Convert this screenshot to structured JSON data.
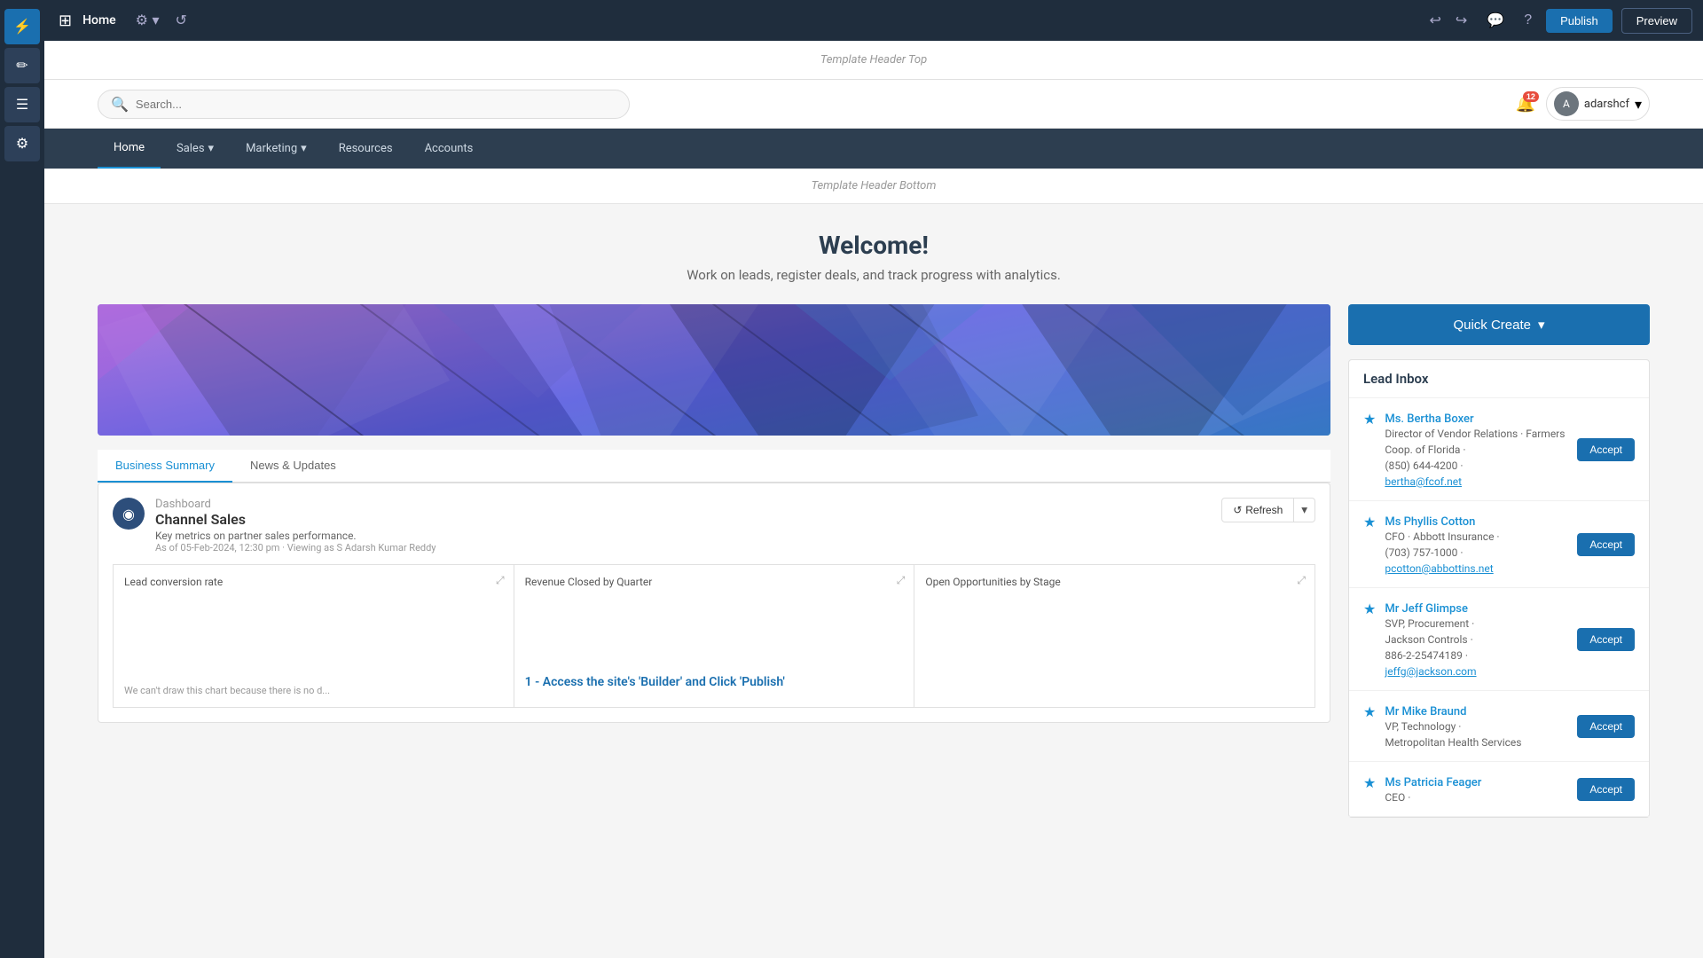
{
  "leftSidebar": {
    "icons": [
      {
        "name": "lightning-icon",
        "symbol": "⚡",
        "active": true
      },
      {
        "name": "pencil-icon",
        "symbol": "✏️",
        "active": false
      },
      {
        "name": "menu-icon",
        "symbol": "☰",
        "active": false
      },
      {
        "name": "gear-icon",
        "symbol": "⚙️",
        "active": false
      }
    ]
  },
  "topBar": {
    "gridIconLabel": "Grid",
    "pageTitle": "Home",
    "settingsLabel": "Settings",
    "refreshLabel": "Refresh page",
    "undoLabel": "Undo",
    "redoLabel": "Redo",
    "commentLabel": "Comment",
    "helpLabel": "Help",
    "publishLabel": "Publish",
    "previewLabel": "Preview"
  },
  "siteNav": {
    "templateHeaderTop": "Template Header Top",
    "searchPlaceholder": "Search...",
    "notificationCount": "12",
    "userName": "adarshcf",
    "navItems": [
      {
        "label": "Home",
        "active": true
      },
      {
        "label": "Sales",
        "hasDropdown": true,
        "active": false
      },
      {
        "label": "Marketing",
        "hasDropdown": true,
        "active": false
      },
      {
        "label": "Resources",
        "active": false
      },
      {
        "label": "Accounts",
        "active": false
      }
    ],
    "templateHeaderBottom": "Template Header Bottom"
  },
  "pageContent": {
    "welcomeTitle": "Welcome!",
    "welcomeSubtitle": "Work on leads, register deals, and track progress with analytics.",
    "tabs": [
      {
        "label": "Business Summary",
        "active": true
      },
      {
        "label": "News & Updates",
        "active": false
      }
    ],
    "dashboard": {
      "iconSymbol": "◉",
      "titleLabel": "Dashboard",
      "name": "Channel Sales",
      "description": "Key metrics on partner sales performance.",
      "meta": "As of 05-Feb-2024, 12:30 pm · Viewing as S Adarsh Kumar Reddy",
      "refreshLabel": "Refresh",
      "charts": [
        {
          "title": "Lead conversion rate",
          "errorMsg": "We can't draw this chart because there is no d...",
          "hasError": true
        },
        {
          "title": "Revenue Closed by Quarter",
          "highlightText": "1 - Access the site's 'Builder' and Click 'Publish'",
          "hasHighlight": true
        },
        {
          "title": "Open Opportunities by Stage",
          "hasError": false
        }
      ]
    }
  },
  "rightPanel": {
    "quickCreateLabel": "Quick Create",
    "quickCreateDropdown": true,
    "leadInbox": {
      "title": "Lead Inbox",
      "leads": [
        {
          "name": "Ms. Bertha Boxer",
          "title": "Director of Vendor Relations",
          "company": "Farmers Coop. of Florida",
          "phone": "(850) 644-4200",
          "email": "bertha@fcof.net",
          "acceptLabel": "Accept"
        },
        {
          "name": "Ms Phyllis Cotton",
          "title": "CFO",
          "company": "Abbott Insurance",
          "phone": "(703) 757-1000",
          "email": "pcotton@abbottins.net",
          "acceptLabel": "Accept"
        },
        {
          "name": "Mr Jeff Glimpse",
          "title": "SVP, Procurement",
          "company": "Jackson Controls",
          "phone": "886-2-25474189",
          "email": "jeffg@jackson.com",
          "acceptLabel": "Accept"
        },
        {
          "name": "Mr Mike Braund",
          "title": "VP, Technology",
          "company": "Metropolitan Health Services",
          "phone": "",
          "email": "",
          "acceptLabel": "Accept"
        },
        {
          "name": "Ms Patricia Feager",
          "title": "CEO",
          "company": "",
          "phone": "",
          "email": "",
          "acceptLabel": "Accept"
        }
      ]
    }
  }
}
